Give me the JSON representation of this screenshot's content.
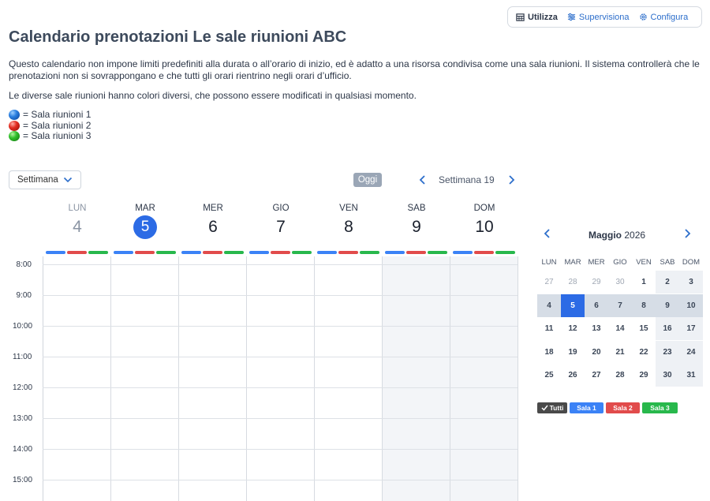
{
  "toolbar": {
    "use_label": "Utilizza",
    "supervise_label": "Supervisiona",
    "configure_label": "Configura"
  },
  "page": {
    "title": "Calendario prenotazioni Le sale riunioni ABC",
    "description1": "Questo calendario non impone limiti predefiniti alla durata o all’orario di inizio, ed è adatto a una risorsa condivisa come una sala riunioni. Il sistema controllerà che le prenotazioni non si sovrappongano e che tutti gli orari rientrino negli orari d’ufficio.",
    "description2": "Le diverse sale riunioni hanno colori diversi, che possono essere modificati in qualsiasi momento."
  },
  "legend": [
    {
      "label": "= Sala riunioni 1",
      "color": "blue"
    },
    {
      "label": "= Sala riunioni 2",
      "color": "red"
    },
    {
      "label": "= Sala riunioni 3",
      "color": "green"
    }
  ],
  "controls": {
    "view_select": "Settimana",
    "today_label": "Oggi",
    "week_label": "Settimana 19"
  },
  "week": {
    "days": [
      {
        "name": "LUN",
        "num": "4",
        "state": "past"
      },
      {
        "name": "MAR",
        "num": "5",
        "state": "today"
      },
      {
        "name": "MER",
        "num": "6",
        "state": "normal"
      },
      {
        "name": "GIO",
        "num": "7",
        "state": "normal"
      },
      {
        "name": "VEN",
        "num": "8",
        "state": "normal"
      },
      {
        "name": "SAB",
        "num": "9",
        "state": "weekend"
      },
      {
        "name": "DOM",
        "num": "10",
        "state": "weekend"
      }
    ],
    "hours": [
      "8:00",
      "9:00",
      "10:00",
      "11:00",
      "12:00",
      "13:00",
      "14:00",
      "15:00"
    ],
    "room_colors": [
      "#3b82f6",
      "#e14b4b",
      "#28b84c"
    ]
  },
  "mini_calendar": {
    "month": "Maggio",
    "year": "2026",
    "weekdays": [
      "LUN",
      "MAR",
      "MER",
      "GIO",
      "VEN",
      "SAB",
      "DOM"
    ],
    "weeks": [
      [
        "27",
        "28",
        "29",
        "30",
        "1",
        "2",
        "3"
      ],
      [
        "4",
        "5",
        "6",
        "7",
        "8",
        "9",
        "10"
      ],
      [
        "11",
        "12",
        "13",
        "14",
        "15",
        "16",
        "17"
      ],
      [
        "18",
        "19",
        "20",
        "21",
        "22",
        "23",
        "24"
      ],
      [
        "25",
        "26",
        "27",
        "28",
        "29",
        "30",
        "31"
      ]
    ],
    "selected_day": "5"
  },
  "filters": {
    "all": "Tutti",
    "room1": "Sala 1",
    "room2": "Sala 2",
    "room3": "Sala 3"
  }
}
